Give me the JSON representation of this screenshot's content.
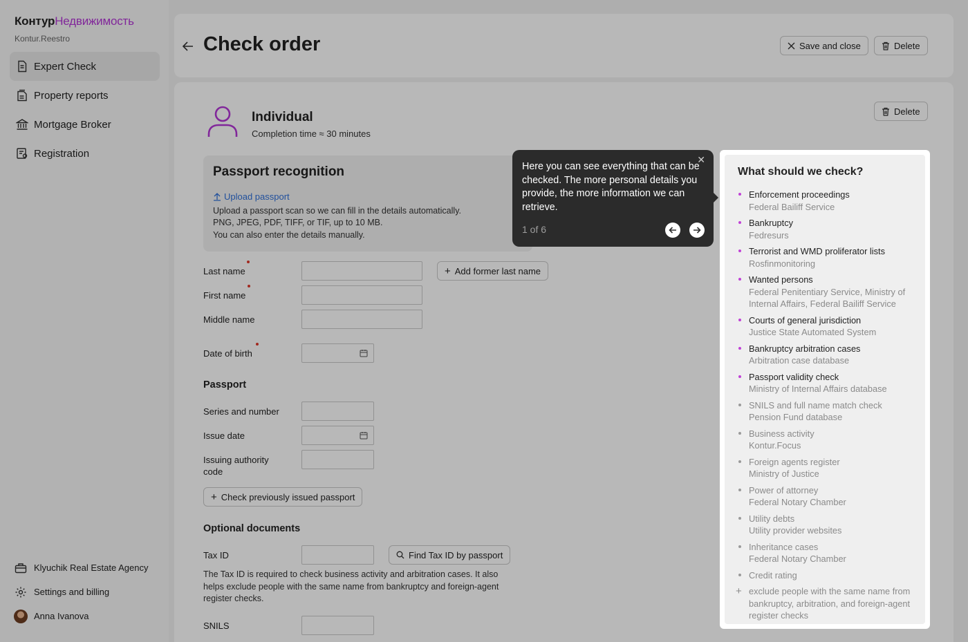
{
  "brand": {
    "name": "Контур",
    "accent": "Недвижимость",
    "sub": "Kontur.Reestro"
  },
  "sidebar": {
    "items": [
      {
        "label": "Expert Check",
        "icon": "document-icon",
        "active": true
      },
      {
        "label": "Property reports",
        "icon": "reports-icon"
      },
      {
        "label": "Mortgage Broker",
        "icon": "bank-icon"
      },
      {
        "label": "Registration",
        "icon": "registration-icon"
      }
    ],
    "footer": [
      {
        "label": "Klyuchik Real Estate Agency",
        "icon": "briefcase-icon"
      },
      {
        "label": "Settings and billing",
        "icon": "gear-icon"
      },
      {
        "label": "Anna Ivanova",
        "icon": "avatar"
      }
    ]
  },
  "header": {
    "title": "Check order",
    "save_close": "Save and close",
    "delete": "Delete"
  },
  "card": {
    "delete": "Delete",
    "title": "Individual",
    "subtitle": "Completion time ≈ 30 minutes"
  },
  "passport_recognition": {
    "title": "Passport recognition",
    "upload": "Upload passport",
    "lines": [
      "Upload a passport scan so we can fill in the details automatically.",
      "PNG, JPEG, PDF, TIFF, or TIF, up to 10 MB.",
      "You can also enter the details manually."
    ]
  },
  "form": {
    "last_name": "Last name",
    "add_former": "Add former last name",
    "first_name": "First name",
    "middle_name": "Middle name",
    "dob": "Date of birth",
    "passport_section": "Passport",
    "series": "Series and number",
    "issue_date": "Issue date",
    "authority_1": "Issuing authority",
    "authority_2": "code",
    "check_prev": "Check previously issued passport",
    "optional_section": "Optional documents",
    "tax_id": "Tax ID",
    "find_tax": "Find Tax ID by passport",
    "tax_help": "The Tax ID is required to check business activity and arbitration cases. It also helps exclude people with the same name from bankruptcy and foreign-agent register checks.",
    "snils": "SNILS"
  },
  "tooltip": {
    "text": "Here you can see everything that can be checked. The more personal details you provide, the more information we can retrieve.",
    "pager": "1 of 6"
  },
  "checks": {
    "title": "What should we check?",
    "items": [
      {
        "title": "Enforcement proceedings",
        "source": "Federal Bailiff Service"
      },
      {
        "title": "Bankruptcy",
        "source": "Fedresurs"
      },
      {
        "title": "Terrorist and WMD proliferator lists",
        "source": "Rosfinmonitoring"
      },
      {
        "title": "Wanted persons",
        "source": "Federal Penitentiary Service, Ministry of Internal Affairs, Federal Bailiff Service"
      },
      {
        "title": "Courts of general jurisdiction",
        "source": "Justice State Automated System"
      },
      {
        "title": "Bankruptcy arbitration cases",
        "source": "Arbitration case database"
      },
      {
        "title": "Passport validity check",
        "source": "Ministry of Internal Affairs database"
      },
      {
        "title": "SNILS and full name match check",
        "source": "Pension Fund database"
      },
      {
        "title": "Business activity",
        "source": "Kontur.Focus"
      },
      {
        "title": "Foreign agents register",
        "source": "Ministry of Justice"
      },
      {
        "title": "Power of attorney",
        "source": "Federal Notary Chamber"
      },
      {
        "title": "Utility debts",
        "source": "Utility provider websites"
      },
      {
        "title": "Inheritance cases",
        "source": "Federal Notary Chamber"
      },
      {
        "title": "Credit rating"
      },
      {
        "title": "exclude people with the same name from bankruptcy, arbitration, and foreign-agent register checks"
      }
    ]
  },
  "colors": {
    "accent": "#b336d6",
    "link": "#2e6fd8",
    "required": "#e0392b",
    "tooltip_bg": "#2b2b2b"
  }
}
